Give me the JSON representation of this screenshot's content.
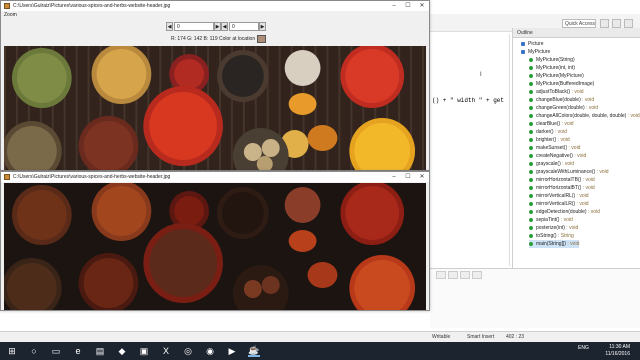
{
  "window_top": {
    "title": "C:\\Users\\Gulraiz\\Pictures\\various-spices-and-herbs-website-header.jpg",
    "menu_label": "Zoom",
    "row_label": "0",
    "col_label": "0",
    "color_text": "R: 174  G: 142  B: 119  Color at location",
    "swatch_color": "#ae8e77"
  },
  "window_bottom": {
    "title": "C:\\Users\\Gulraiz\\Pictures\\various-spices-and-herbs-website-header.jpg"
  },
  "ide": {
    "quick_access": "Quick Access",
    "code_fragment_a": "() + \" width \" + get",
    "cursor_marker": "I",
    "outline_title": "Outline",
    "outline_items": [
      {
        "label": "Picture",
        "ret": "",
        "kind": "class"
      },
      {
        "label": "MyPicture",
        "ret": "",
        "kind": "class"
      },
      {
        "label": "MyPicture(String)",
        "ret": "",
        "kind": "method"
      },
      {
        "label": "MyPicture(int, int)",
        "ret": "",
        "kind": "method"
      },
      {
        "label": "MyPicture(MyPicture)",
        "ret": "",
        "kind": "method"
      },
      {
        "label": "MyPicture(BufferedImage)",
        "ret": "",
        "kind": "method"
      },
      {
        "label": "adjustToBlack()",
        "ret": " : void",
        "kind": "method"
      },
      {
        "label": "changeBlue(double)",
        "ret": " : void",
        "kind": "method"
      },
      {
        "label": "changeGreen(double)",
        "ret": " : void",
        "kind": "method"
      },
      {
        "label": "changeAllColors(double, double, double)",
        "ret": " : void",
        "kind": "method"
      },
      {
        "label": "clearBlue()",
        "ret": " : void",
        "kind": "method"
      },
      {
        "label": "darker()",
        "ret": " : void",
        "kind": "method"
      },
      {
        "label": "brighter()",
        "ret": " : void",
        "kind": "method"
      },
      {
        "label": "makeSunset()",
        "ret": " : void",
        "kind": "method"
      },
      {
        "label": "createNegative()",
        "ret": " : void",
        "kind": "method"
      },
      {
        "label": "grayscale()",
        "ret": " : void",
        "kind": "method"
      },
      {
        "label": "grayscaleWithLuminance()",
        "ret": " : void",
        "kind": "method"
      },
      {
        "label": "mirrorHorizontalTB()",
        "ret": " : void",
        "kind": "method"
      },
      {
        "label": "mirrorHorizontalBT()",
        "ret": " : void",
        "kind": "method"
      },
      {
        "label": "mirrorVerticalRL()",
        "ret": " : void",
        "kind": "method"
      },
      {
        "label": "mirrorVerticalLR()",
        "ret": " : void",
        "kind": "method"
      },
      {
        "label": "edgeDetection(double)",
        "ret": " : void",
        "kind": "method"
      },
      {
        "label": "sepiaTint()",
        "ret": " : void",
        "kind": "method"
      },
      {
        "label": "posterize(int)",
        "ret": " : void",
        "kind": "method"
      },
      {
        "label": "toString()",
        "ret": " : String",
        "kind": "method"
      },
      {
        "label": "main(String[])",
        "ret": " : void",
        "kind": "method"
      }
    ],
    "status": {
      "writable": "Writable",
      "insert_mode": "Smart Insert",
      "position": "402 : 23"
    }
  },
  "taskbar": {
    "time": "11:30 AM",
    "date": "11/16/2016",
    "lang": "ENG",
    "icons": [
      "start-icon",
      "search-icon",
      "task-view-icon",
      "edge-icon",
      "explorer-icon",
      "dropbox-icon",
      "store-icon",
      "excel-icon",
      "python-icon",
      "chrome-icon",
      "terminal-icon",
      "java-icon"
    ]
  },
  "colors": {
    "taskbar_bg": "#1c2430",
    "swatch": "#ae8e77"
  }
}
